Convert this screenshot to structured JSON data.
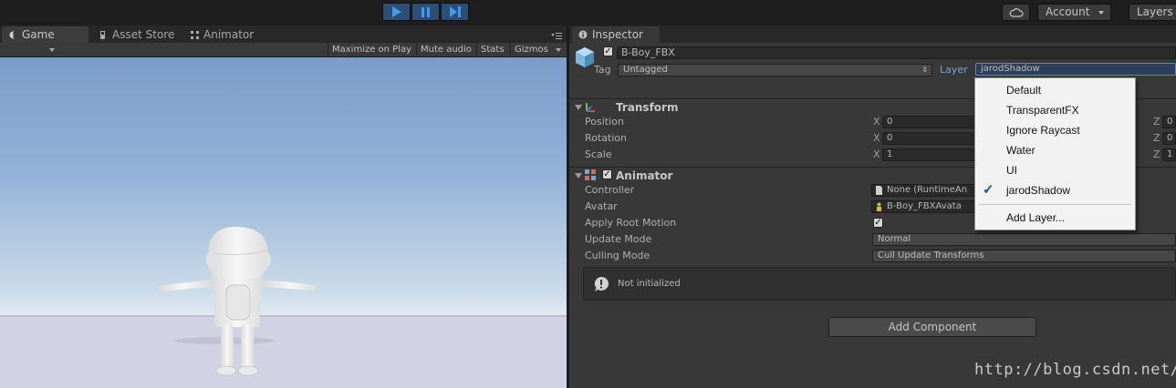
{
  "toolbar": {
    "play_controls": [
      "play-icon",
      "pause-icon",
      "step-icon"
    ],
    "account_label": "Account",
    "layers_label": "Layers"
  },
  "game_panel": {
    "tabs": [
      {
        "label": "Game",
        "icon": "game-icon",
        "active": true
      },
      {
        "label": "Asset Store",
        "icon": "asset-store-icon",
        "active": false
      },
      {
        "label": "Animator",
        "icon": "animator-icon",
        "active": false
      }
    ],
    "toolbar_items": {
      "maximize": "Maximize on Play",
      "mute": "Mute audio",
      "stats": "Stats",
      "gizmos": "Gizmos"
    }
  },
  "inspector": {
    "tab_label": "Inspector",
    "object_name": "B-Boy_FBX",
    "object_active": true,
    "tag_label": "Tag",
    "tag_value": "Untagged",
    "layer_label": "Layer",
    "layer_value": "jarodShadow",
    "transform": {
      "title": "Transform",
      "rows": [
        {
          "label": "Position",
          "x": "0",
          "z": "0"
        },
        {
          "label": "Rotation",
          "x": "0",
          "z": "0"
        },
        {
          "label": "Scale",
          "x": "1",
          "z": "1"
        }
      ],
      "axis_x": "X",
      "axis_z": "Z"
    },
    "animator": {
      "title": "Animator",
      "enabled": true,
      "rows": {
        "controller_label": "Controller",
        "controller_value": "None (RuntimeAn",
        "avatar_label": "Avatar",
        "avatar_value": "B-Boy_FBXAvata",
        "apply_root_motion_label": "Apply Root Motion",
        "apply_root_motion": true,
        "update_mode_label": "Update Mode",
        "update_mode_value": "Normal",
        "culling_mode_label": "Culling Mode",
        "culling_mode_value": "Cull Update Transforms"
      },
      "notice": "Not initialized"
    },
    "add_component_label": "Add Component"
  },
  "layer_menu": {
    "items": [
      {
        "label": "Default",
        "checked": false
      },
      {
        "label": "TransparentFX",
        "checked": false
      },
      {
        "label": "Ignore Raycast",
        "checked": false
      },
      {
        "label": "Water",
        "checked": false
      },
      {
        "label": "UI",
        "checked": false
      },
      {
        "label": "jarodShadow",
        "checked": true
      }
    ],
    "add_layer_label": "Add Layer...",
    "check_glyph": "✓"
  },
  "watermark": "http://blog.csdn.net/",
  "colors": {
    "play_accent": "#3d9cf0",
    "editor_bg": "#383838",
    "menu_bg": "#f2f2f2"
  }
}
